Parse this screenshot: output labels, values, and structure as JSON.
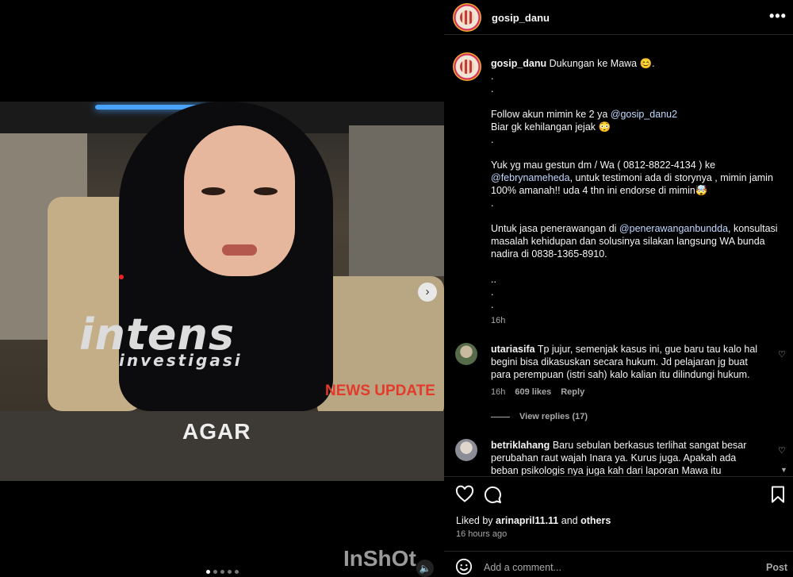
{
  "media": {
    "overlay_title": "intens",
    "overlay_subtitle": "investigasi",
    "news_label": "NEWS UPDATE",
    "subtitle_word": "AGAR",
    "watermark": "InShOt",
    "next_icon": "›",
    "sound_icon": "🔈",
    "carousel_count": 5,
    "carousel_active": 1
  },
  "header": {
    "username": "gosip_danu",
    "more_icon": "•••"
  },
  "post": {
    "username": "gosip_danu",
    "caption_first": "Dukungan ke Mawa 😊.",
    "lines": [
      ".",
      ".",
      "",
      "Follow akun mimin ke 2 ya ",
      "Biar gk kehilangan jejak 😳",
      ".",
      "",
      "Yuk yg mau gestun dm / Wa ( 0812-8822-4134 ) ke",
      "",
      "100% amanah!! uda 4 thn ini endorse di mimin🤯",
      ".",
      "",
      "Untuk jasa penerawangan di ",
      "masalah kehidupan dan solusinya silakan langsung WA bunda",
      "nadira di 0838-1365-8910.",
      "",
      "..",
      ".",
      "."
    ],
    "mention_follow": "@gosip_danu2",
    "mention_gestun": "@febrynameheda",
    "gestun_tail": ", untuk testimoni ada di storynya , mimin jamin",
    "mention_pener": "@penerawanganbundda",
    "pener_tail": ", konsultasi",
    "time": "16h"
  },
  "comments": [
    {
      "username": "utariasifa",
      "text": "Tp jujur, semenjak kasus ini, gue baru tau kalo hal begini bisa dikasuskan secara hukum. Jd pelajaran jg buat para perempuan (istri sah) kalo kalian itu dilindungi hukum.",
      "time": "16h",
      "likes": "609 likes",
      "reply": "Reply",
      "view_replies": "View replies (17)"
    },
    {
      "username": "betriklahang",
      "text": "Baru sebulan berkasus terlihat sangat besar perubahan raut wajah Inara ya. Kurus juga. Apakah ada beban psikologis nya juga kah dari laporan Mawa itu"
    }
  ],
  "footer": {
    "liked_prefix": "Liked by ",
    "liked_user": "arinapril11.11",
    "liked_and": " and ",
    "liked_others": "others",
    "time_ago": "16 hours ago",
    "add_comment_placeholder": "Add a comment...",
    "post_label": "Post"
  }
}
